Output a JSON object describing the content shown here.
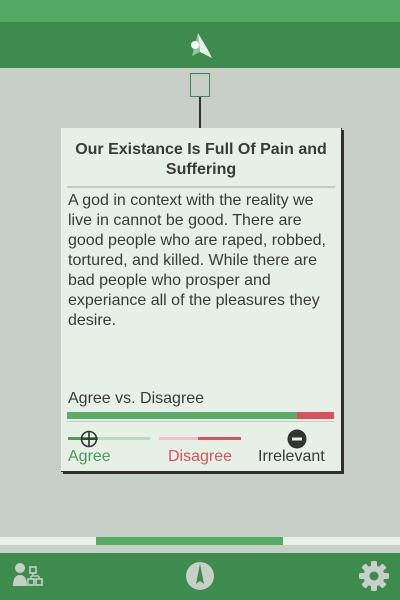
{
  "card": {
    "title": "Our Existance Is Full Of Pain and Suffering",
    "body": "A god in context with the reality we live in cannot be good. There are good people who are raped, robbed, tortured, and killed. While there are bad people who prosper and experiance all of the pleasures they desire."
  },
  "vote_summary": {
    "label": "Agree vs. Disagree",
    "agree_fraction": 0.86
  },
  "vote_buttons": {
    "agree": "Agree",
    "disagree": "Disagree",
    "irrelevant": "Irrelevant"
  },
  "colors": {
    "header": "#3d8b4d",
    "status_bar": "#56a865",
    "agree": "#5aac66",
    "disagree": "#d9515a",
    "background": "#c8cfc8",
    "card": "#e6f0e6"
  },
  "icons": {
    "header": "app-logo-icon",
    "footer_left": "users-network-icon",
    "footer_center": "compass-icon",
    "footer_right": "gear-icon"
  }
}
